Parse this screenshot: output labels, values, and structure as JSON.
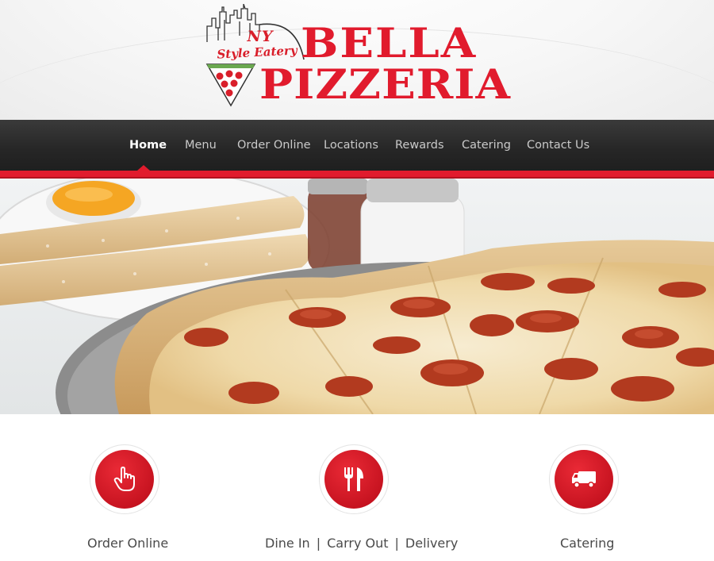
{
  "logo": {
    "badge_text": "NY",
    "tagline": "Style Eatery",
    "name_line1": "BELLA",
    "name_line2": "PIZZERIA",
    "brand_red": "#e11b2d"
  },
  "nav": {
    "items": [
      {
        "label": "Home",
        "active": true
      },
      {
        "label": "Menu",
        "active": false
      },
      {
        "label": "Order Online",
        "active": false
      },
      {
        "label": "Locations",
        "active": false
      },
      {
        "label": "Rewards",
        "active": false
      },
      {
        "label": "Catering",
        "active": false
      },
      {
        "label": "Contact Us",
        "active": false
      }
    ],
    "bar_color": "#262626",
    "accent": "#e11b2d"
  },
  "features": [
    {
      "icon": "pointing-hand-icon",
      "label": "Order Online"
    },
    {
      "icon": "fork-knife-icon",
      "labels": [
        "Dine In",
        "Carry Out",
        "Delivery"
      ],
      "separator": "|"
    },
    {
      "icon": "delivery-truck-icon",
      "label": "Catering"
    }
  ]
}
